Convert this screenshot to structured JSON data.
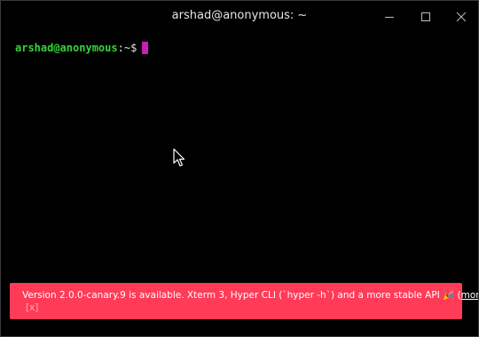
{
  "window": {
    "title": "arshad@anonymous: ~"
  },
  "terminal": {
    "user_host": "arshad@anonymous",
    "colon": ":",
    "path": "~",
    "dollar": "$"
  },
  "notification": {
    "text_before": "Version 2.0.0-canary.9 is available. Xterm 3, Hyper CLI (`hyper -h`) and a more stable API 🎉 (",
    "more_label": "more",
    "text_after": ")",
    "dismiss_label": "[x]"
  },
  "colors": {
    "notification_bg": "#ff3b57",
    "prompt_user": "#34d23a",
    "cursor": "#c51fb6"
  }
}
